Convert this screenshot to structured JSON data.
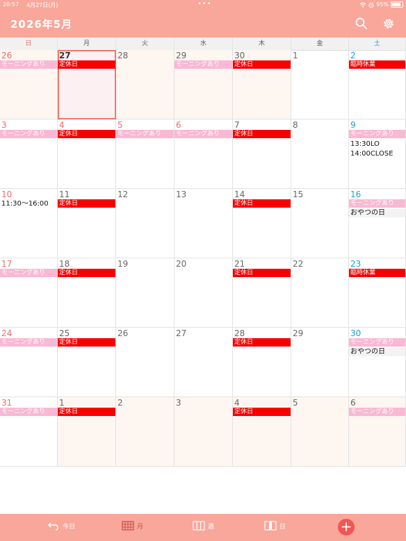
{
  "status_bar": {
    "time": "20:57",
    "date": "4月27日(月)",
    "dots": "•••",
    "battery": "95%",
    "battery_level": 0.95
  },
  "header": {
    "title": "2026年5月",
    "search_icon": "search-icon",
    "settings_icon": "gear-icon"
  },
  "weekdays": [
    "日",
    "月",
    "火",
    "水",
    "木",
    "金",
    "土"
  ],
  "colors": {
    "accent": "#f9a79b",
    "holiday_red": "#f60000",
    "morning_pink": "#f9b8d3",
    "sunday": "#f26b6b",
    "saturday": "#1aa0d8"
  },
  "weeks": [
    [
      {
        "day": "26",
        "out": true,
        "events": [
          {
            "t": "モーニングあり",
            "s": "pink"
          }
        ]
      },
      {
        "day": "27",
        "out": true,
        "today": true,
        "events": [
          {
            "t": "定休日",
            "s": "red"
          }
        ]
      },
      {
        "day": "28",
        "out": true,
        "events": []
      },
      {
        "day": "29",
        "out": true,
        "events": [
          {
            "t": "モーニングあり",
            "s": "pink"
          }
        ]
      },
      {
        "day": "30",
        "out": true,
        "events": [
          {
            "t": "定休日",
            "s": "red"
          }
        ]
      },
      {
        "day": "1",
        "events": []
      },
      {
        "day": "2",
        "events": [
          {
            "t": "臨時休業",
            "s": "red"
          }
        ]
      }
    ],
    [
      {
        "day": "3",
        "events": [
          {
            "t": "モーニングあり",
            "s": "pink"
          }
        ]
      },
      {
        "day": "4",
        "holiday": true,
        "events": [
          {
            "t": "定休日",
            "s": "red"
          }
        ]
      },
      {
        "day": "5",
        "holiday": true,
        "events": [
          {
            "t": "モーニングあり",
            "s": "pink"
          }
        ]
      },
      {
        "day": "6",
        "holiday": true,
        "events": [
          {
            "t": "モーニングあり",
            "s": "pink"
          }
        ]
      },
      {
        "day": "7",
        "events": [
          {
            "t": "定休日",
            "s": "red"
          }
        ]
      },
      {
        "day": "8",
        "events": []
      },
      {
        "day": "9",
        "events": [
          {
            "t": "モーニングあり",
            "s": "pink"
          },
          {
            "t": "13:30LO",
            "s": "plain"
          },
          {
            "t": "14:00CLOSE",
            "s": "plain"
          }
        ]
      }
    ],
    [
      {
        "day": "10",
        "events": [
          {
            "t": "11:30〜16:00",
            "s": "plain"
          }
        ]
      },
      {
        "day": "11",
        "events": [
          {
            "t": "定休日",
            "s": "red"
          }
        ]
      },
      {
        "day": "12",
        "events": []
      },
      {
        "day": "13",
        "events": []
      },
      {
        "day": "14",
        "events": [
          {
            "t": "定休日",
            "s": "red"
          }
        ]
      },
      {
        "day": "15",
        "events": []
      },
      {
        "day": "16",
        "events": [
          {
            "t": "モーニングあり",
            "s": "pink"
          },
          {
            "t": "おやつの日",
            "s": "gray"
          }
        ]
      }
    ],
    [
      {
        "day": "17",
        "events": [
          {
            "t": "モーニングあり",
            "s": "pink"
          }
        ]
      },
      {
        "day": "18",
        "events": [
          {
            "t": "定休日",
            "s": "red"
          }
        ]
      },
      {
        "day": "19",
        "events": []
      },
      {
        "day": "20",
        "events": []
      },
      {
        "day": "21",
        "events": [
          {
            "t": "定休日",
            "s": "red"
          }
        ]
      },
      {
        "day": "22",
        "events": []
      },
      {
        "day": "23",
        "events": [
          {
            "t": "臨時休業",
            "s": "red"
          }
        ]
      }
    ],
    [
      {
        "day": "24",
        "events": [
          {
            "t": "モーニングあり",
            "s": "pink"
          }
        ]
      },
      {
        "day": "25",
        "events": [
          {
            "t": "定休日",
            "s": "red"
          }
        ]
      },
      {
        "day": "26",
        "events": []
      },
      {
        "day": "27",
        "events": []
      },
      {
        "day": "28",
        "events": [
          {
            "t": "定休日",
            "s": "red"
          }
        ]
      },
      {
        "day": "29",
        "events": []
      },
      {
        "day": "30",
        "events": [
          {
            "t": "モーニングあり",
            "s": "pink"
          },
          {
            "t": "おやつの日",
            "s": "gray"
          }
        ]
      }
    ],
    [
      {
        "day": "31",
        "events": [
          {
            "t": "モーニングあり",
            "s": "pink"
          }
        ]
      },
      {
        "day": "1",
        "out": true,
        "events": [
          {
            "t": "定休日",
            "s": "red"
          }
        ]
      },
      {
        "day": "2",
        "out": true,
        "events": []
      },
      {
        "day": "3",
        "out": true,
        "events": []
      },
      {
        "day": "4",
        "out": true,
        "events": [
          {
            "t": "定休日",
            "s": "red"
          }
        ]
      },
      {
        "day": "5",
        "out": true,
        "events": []
      },
      {
        "day": "6",
        "out": true,
        "events": [
          {
            "t": "モーニングあり",
            "s": "pink"
          }
        ]
      }
    ]
  ],
  "toolbar": {
    "today_label": "今日",
    "today_icon": "undo-arrow-icon",
    "month_label": "月",
    "month_icon": "month-grid-icon",
    "week_label": "週",
    "week_icon": "week-columns-icon",
    "day_label": "日",
    "day_icon": "day-single-icon",
    "add_label": "+",
    "add_icon": "plus-icon"
  }
}
